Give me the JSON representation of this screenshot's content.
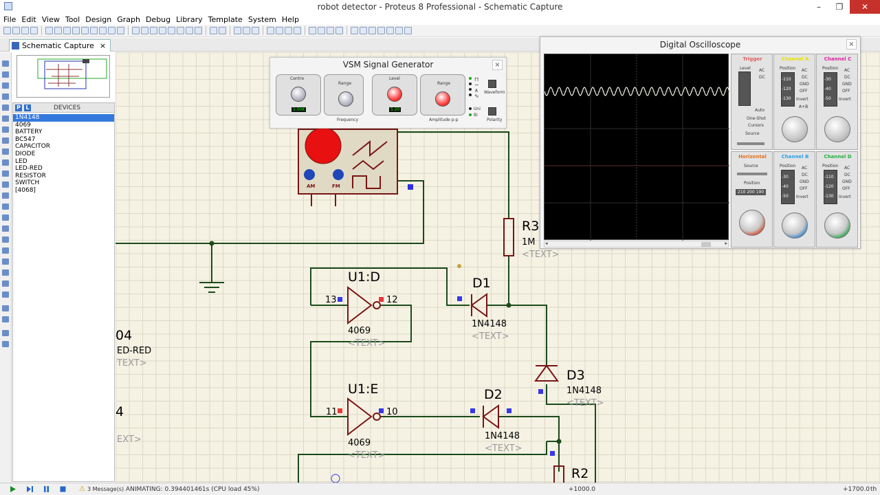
{
  "window": {
    "title": "robot detector - Proteus 8 Professional - Schematic Capture"
  },
  "menu": [
    "File",
    "Edit",
    "View",
    "Tool",
    "Design",
    "Graph",
    "Debug",
    "Library",
    "Template",
    "System",
    "Help"
  ],
  "tab": {
    "label": "Schematic Capture",
    "close": "×"
  },
  "devices": {
    "title": "DEVICES",
    "picker_p": "P",
    "picker_l": "L",
    "items": [
      "1N4148",
      "4069",
      "BATTERY",
      "BC547",
      "CAPACITOR",
      "DIODE",
      "LED",
      "LED-RED",
      "RESISTOR",
      "SWITCH",
      "[4068]"
    ],
    "selected": "1N4148"
  },
  "schematic": {
    "u1d": {
      "ref": "U1:D",
      "part": "4069",
      "text": "<TEXT>",
      "pin_in": "13",
      "pin_out": "12"
    },
    "u1e": {
      "ref": "U1:E",
      "part": "4069",
      "text": "<TEXT>",
      "pin_in": "11",
      "pin_out": "10"
    },
    "d1": {
      "ref": "D1",
      "part": "1N4148",
      "text": "<TEXT>"
    },
    "d2": {
      "ref": "D2",
      "part": "1N4148",
      "text": "<TEXT>"
    },
    "d3": {
      "ref": "D3",
      "part": "1N4148",
      "text": "<TEXT>"
    },
    "r3": {
      "ref": "R3",
      "value": "1M",
      "text": "<TEXT>"
    },
    "r2": {
      "ref": "R2"
    },
    "d4_partial": {
      "ref": "04",
      "part": "ED-RED",
      "text": "TEXT>"
    },
    "partial_left2": {
      "ref": "4",
      "text": "EXT>"
    },
    "gen_labels": {
      "am": "AM",
      "fm": "FM"
    }
  },
  "signal_generator": {
    "title": "VSM Signal Generator",
    "close": "×",
    "centre_label": "Centre",
    "range_label": "Range",
    "level_label": "Level",
    "amp_range_label": "Range",
    "frequency_label": "Frequency",
    "amplitude_label": "Amplitude p-p",
    "waveform_label": "Waveform",
    "polarity_label": "Polarity",
    "uni_label": "Uni",
    "bi_label": "Bi",
    "freq_display": "1.00K",
    "level_display": "5.20"
  },
  "oscilloscope": {
    "title": "Digital Oscilloscope",
    "close": "×",
    "trigger": {
      "name": "Trigger",
      "level": "Level",
      "ac": "AC",
      "dc": "DC",
      "auto": "Auto",
      "one_shot": "One-Shot",
      "cursors": "Cursors",
      "source": "Source"
    },
    "horizontal": {
      "name": "Horizontal",
      "source": "Source",
      "position": "Position",
      "readout": "210 200 190"
    },
    "channels": [
      {
        "name": "Channel A",
        "color": "#e8e000",
        "position": "Position",
        "readout": "-110 -120 -130",
        "modes": [
          "AC",
          "DC",
          "GND",
          "OFF",
          "Invert",
          "A+B"
        ]
      },
      {
        "name": "Channel C",
        "color": "#e020a0",
        "position": "Position",
        "readout": "-30 -40 -50",
        "modes": [
          "AC",
          "DC",
          "GND",
          "OFF",
          "Invert"
        ]
      },
      {
        "name": "Channel B",
        "color": "#2aa0e8",
        "position": "Position",
        "readout": "-30 -40 -50",
        "modes": [
          "AC",
          "DC",
          "GND",
          "OFF",
          "Invert"
        ]
      },
      {
        "name": "Channel D",
        "color": "#20b040",
        "position": "Position",
        "readout": "-110 -120 -130",
        "modes": [
          "AC",
          "DC",
          "GND",
          "OFF",
          "Invert"
        ]
      }
    ],
    "trace_color": "#f2f2e0"
  },
  "status": {
    "messages": "3 Message(s)",
    "animating": "ANIMATING: 0.394401461s (CPU load 45%)",
    "coord_x": "+1000.0",
    "coord_y": "+1700.0",
    "unit": "th"
  }
}
